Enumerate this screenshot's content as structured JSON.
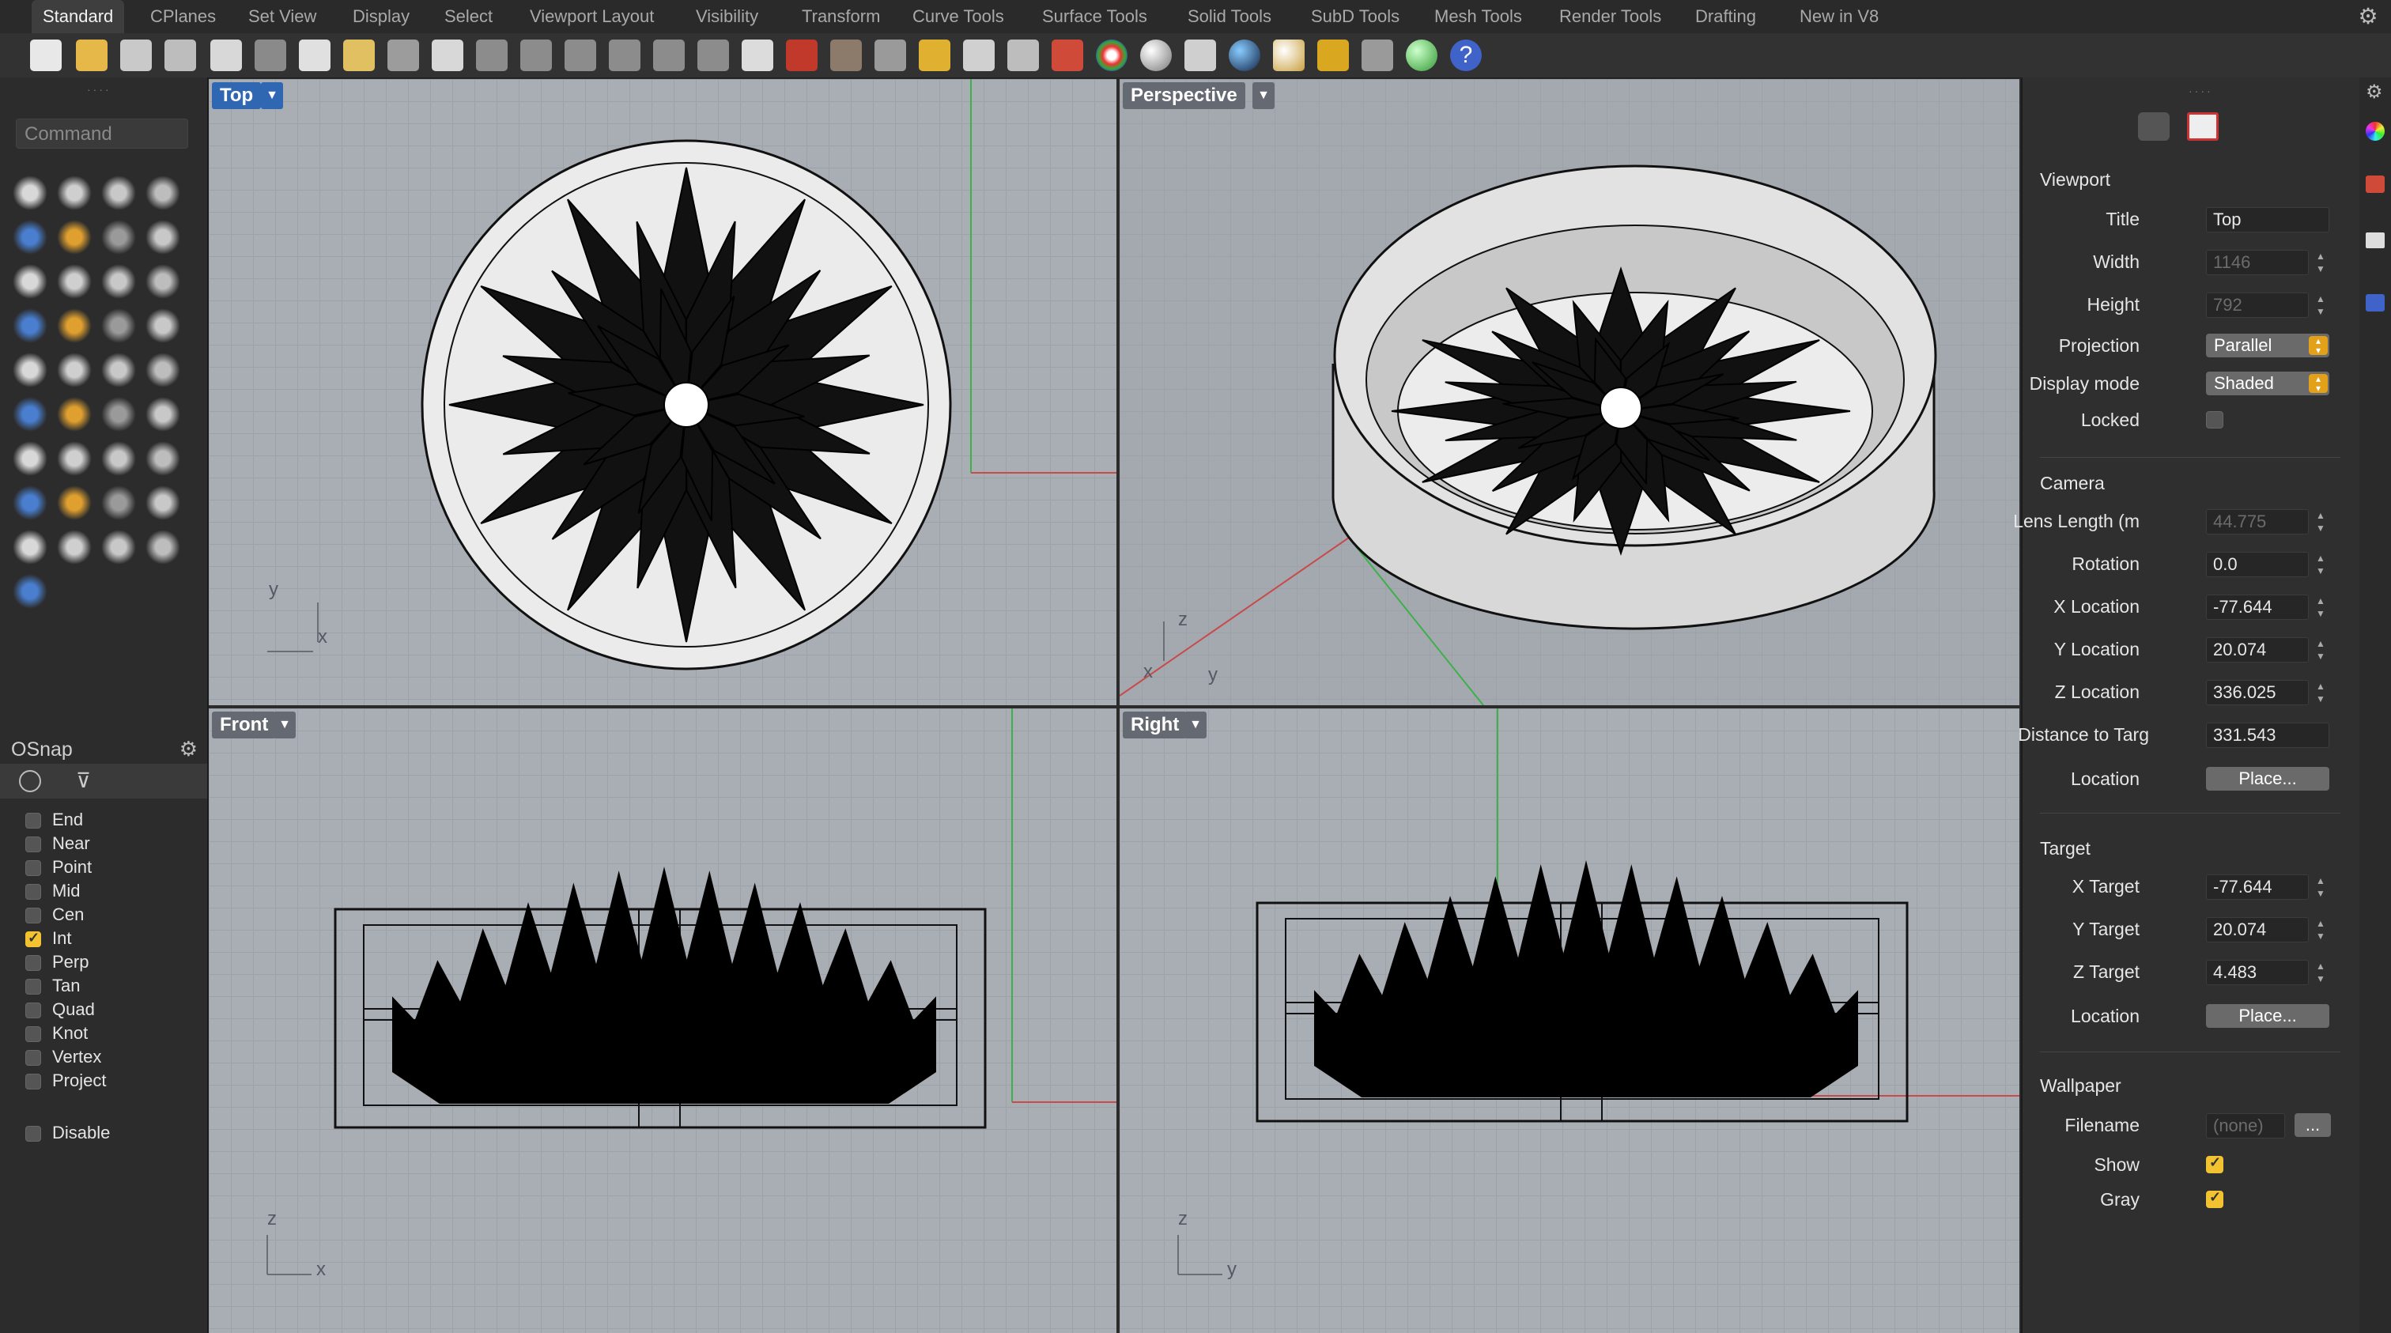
{
  "tabs": [
    "Standard",
    "CPlanes",
    "Set View",
    "Display",
    "Select",
    "Viewport Layout",
    "Visibility",
    "Transform",
    "Curve Tools",
    "Surface Tools",
    "Solid Tools",
    "SubD Tools",
    "Mesh Tools",
    "Render Tools",
    "Drafting",
    "New in V8"
  ],
  "command": {
    "placeholder": "Command"
  },
  "osnap": {
    "title": "OSnap",
    "items": [
      {
        "label": "End",
        "checked": false
      },
      {
        "label": "Near",
        "checked": false
      },
      {
        "label": "Point",
        "checked": false
      },
      {
        "label": "Mid",
        "checked": false
      },
      {
        "label": "Cen",
        "checked": false
      },
      {
        "label": "Int",
        "checked": true
      },
      {
        "label": "Perp",
        "checked": false
      },
      {
        "label": "Tan",
        "checked": false
      },
      {
        "label": "Quad",
        "checked": false
      },
      {
        "label": "Knot",
        "checked": false
      },
      {
        "label": "Vertex",
        "checked": false
      },
      {
        "label": "Project",
        "checked": false
      }
    ],
    "disable": {
      "label": "Disable",
      "checked": false
    }
  },
  "viewports": {
    "top": {
      "title": "Top",
      "axis_a": "y",
      "axis_b": "x"
    },
    "perspective": {
      "title": "Perspective",
      "axis_a": "z",
      "axis_b": "x",
      "axis_c": "y"
    },
    "front": {
      "title": "Front",
      "axis_a": "z",
      "axis_b": "x"
    },
    "right": {
      "title": "Right",
      "axis_a": "z",
      "axis_b": "y"
    }
  },
  "properties": {
    "viewport": {
      "heading": "Viewport",
      "title_label": "Title",
      "title_value": "Top",
      "width_label": "Width",
      "width_value": "1146",
      "height_label": "Height",
      "height_value": "792",
      "projection_label": "Projection",
      "projection_value": "Parallel",
      "display_label": "Display mode",
      "display_value": "Shaded",
      "locked_label": "Locked"
    },
    "camera": {
      "heading": "Camera",
      "lens_label": "Lens Length (m",
      "lens_value": "44.775",
      "rotation_label": "Rotation",
      "rotation_value": "0.0",
      "xloc_label": "X Location",
      "xloc_value": "-77.644",
      "yloc_label": "Y Location",
      "yloc_value": "20.074",
      "zloc_label": "Z Location",
      "zloc_value": "336.025",
      "dist_label": "Distance to Targ",
      "dist_value": "331.543",
      "location_label": "Location",
      "place_label": "Place..."
    },
    "target": {
      "heading": "Target",
      "x_label": "X Target",
      "x_value": "-77.644",
      "y_label": "Y Target",
      "y_value": "20.074",
      "z_label": "Z Target",
      "z_value": "4.483",
      "location_label": "Location",
      "place_label": "Place..."
    },
    "wallpaper": {
      "heading": "Wallpaper",
      "filename_label": "Filename",
      "filename_value": "(none)",
      "browse_label": "...",
      "show_label": "Show",
      "gray_label": "Gray"
    }
  },
  "colors": {
    "accent": "#f2c230",
    "active_viewport": "#2f67b2",
    "viewport_bg": "#a9adb4"
  }
}
